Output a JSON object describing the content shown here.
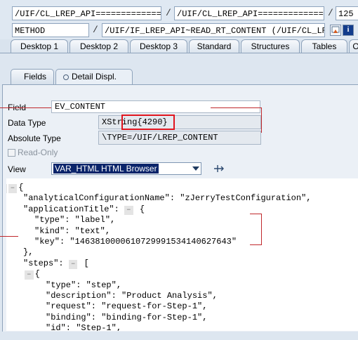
{
  "header": {
    "row1": {
      "program": "/UIF/CL_LREP_API===============",
      "include": "/UIF/CL_LREP_API===============",
      "line": "125"
    },
    "row2": {
      "type": "METHOD",
      "name": "/UIF/IF_LREP_API~READ_RT_CONTENT (/UIF/CL_LREP",
      "help_icon_glyph": "i"
    }
  },
  "desktop_tabs": [
    "Desktop 1",
    "Desktop 2",
    "Desktop 3",
    "Standard",
    "Structures",
    "Tables",
    "O"
  ],
  "sub_tabs": {
    "fields": "Fields",
    "detail": "Detail Displ."
  },
  "form": {
    "field_label": "Field",
    "field_value": "EV_CONTENT",
    "data_type_label": "Data Type",
    "data_type_value": "XString{4290}",
    "absolute_type_label": "Absolute Type",
    "absolute_type_value": "\\TYPE=/UIF/LREP_CONTENT",
    "read_only_label": "Read-Only",
    "view_label": "View",
    "view_value": "VAR_HTML HTML Browser"
  },
  "code_lines": [
    {
      "text": "{",
      "ctl": [
        "+",
        "–"
      ],
      "indent": 0
    },
    {
      "text": "\"analyticalConfigurationName\": \"zJerryTestConfiguration\",",
      "ctl": [],
      "indent": 1
    },
    {
      "text": "\"applicationTitle\": ",
      "ctl_after": "–",
      "after": " {",
      "indent": 1
    },
    {
      "text": "\"type\": \"label\",",
      "ctl": [],
      "indent": 2
    },
    {
      "text": "\"kind\": \"text\",",
      "ctl": [],
      "indent": 2
    },
    {
      "text": "\"key\": \"1463810000610729991534140627643\"",
      "ctl": [],
      "indent": 2
    },
    {
      "text": "},",
      "ctl": [],
      "indent": 1
    },
    {
      "text": "\"steps\": ",
      "ctl_after": "–",
      "after": " [",
      "indent": 1
    },
    {
      "text": "{",
      "ctl": [
        "–"
      ],
      "indent": 2
    },
    {
      "text": "\"type\": \"step\",",
      "ctl": [],
      "indent": 3
    },
    {
      "text": "\"description\": \"Product Analysis\",",
      "ctl": [],
      "indent": 3
    },
    {
      "text": "\"request\": \"request-for-Step-1\",",
      "ctl": [],
      "indent": 3
    },
    {
      "text": "\"binding\": \"binding-for-Step-1\",",
      "ctl": [],
      "indent": 3
    },
    {
      "text": "\"id\": \"Step-1\",",
      "ctl": [],
      "indent": 3
    }
  ],
  "colors": {
    "annotation_red": "#e0141e",
    "selection_blue": "#0a246a"
  }
}
